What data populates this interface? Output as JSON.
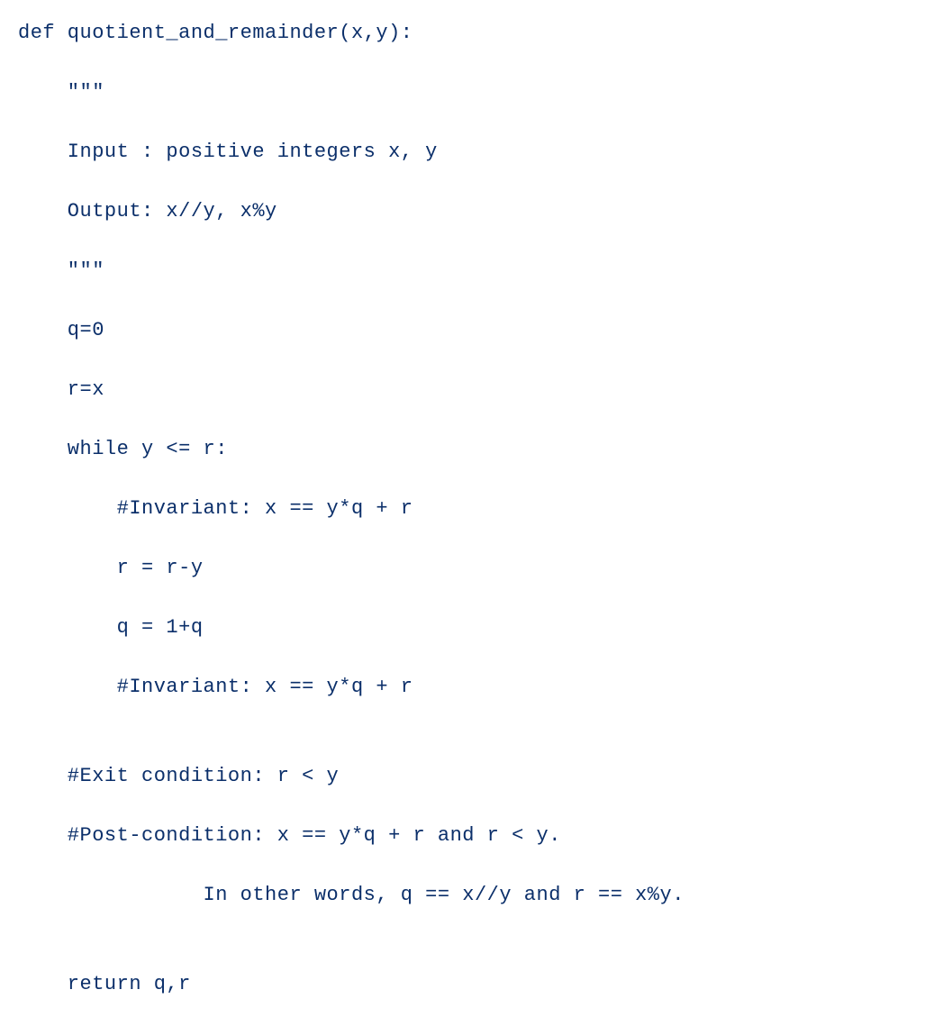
{
  "code": {
    "lines": [
      "def quotient_and_remainder(x,y):",
      "    \"\"\"",
      "    Input : positive integers x, y",
      "    Output: x//y, x%y",
      "    \"\"\"",
      "    q=0",
      "    r=x",
      "    while y <= r:",
      "        #Invariant: x == y*q + r",
      "        r = r-y",
      "        q = 1+q",
      "        #Invariant: x == y*q + r",
      "",
      "    #Exit condition: r < y",
      "    #Post-condition: x == y*q + r and r < y.",
      "               In other words, q == x//y and r == x%y.",
      "",
      "    return q,r"
    ]
  }
}
